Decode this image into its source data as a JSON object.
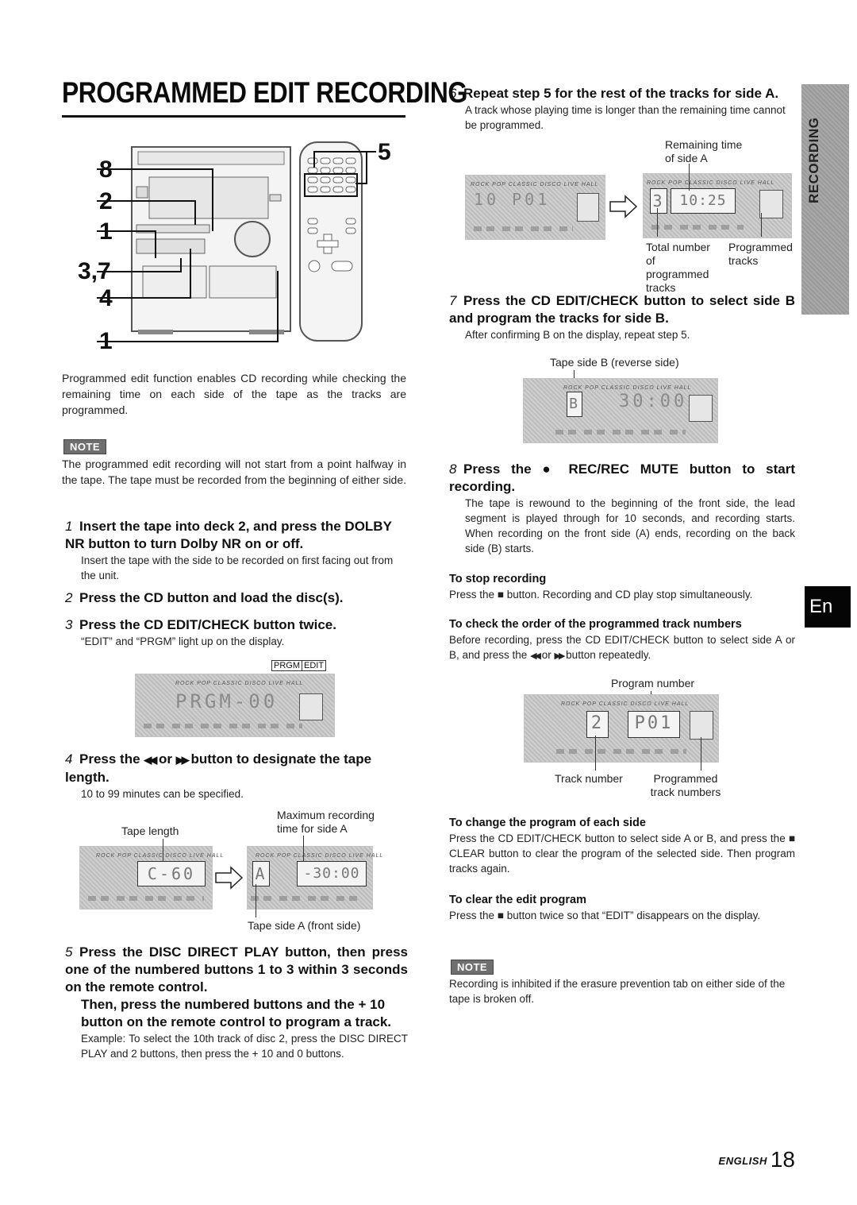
{
  "page": {
    "title": "PROGRAMMED EDIT RECORDING",
    "side_tab": "RECORDING",
    "lang_tab": "En",
    "footer_lang": "ENGLISH",
    "page_number": "18"
  },
  "illustration": {
    "callouts_left": [
      "8",
      "2",
      "1",
      "3,7",
      "4",
      "1"
    ],
    "callout_right": "5"
  },
  "intro": "Programmed edit function enables CD recording while checking the remaining time on each side of the tape as the tracks are programmed.",
  "note1": {
    "badge": "NOTE",
    "text": "The programmed edit recording will not start from a point halfway in the tape. The tape must be recorded from the beginning of either side."
  },
  "steps": [
    {
      "num": "1",
      "head": "Insert the tape into deck 2, and press the DOLBY NR button to turn Dolby NR on or off.",
      "body": "Insert the tape with the side to be recorded on first facing out from the unit."
    },
    {
      "num": "2",
      "head": "Press the CD button and load the disc(s).",
      "body": ""
    },
    {
      "num": "3",
      "head": "Press the CD EDIT/CHECK button twice.",
      "body": "“EDIT” and “PRGM” light up on the display."
    },
    {
      "num": "4",
      "head_pre": "Press the ",
      "head_rew": "◀◀",
      "head_mid": " or ",
      "head_ff": "▶▶",
      "head_post": " button to designate the tape length.",
      "body": "10 to 99 minutes can be specified."
    },
    {
      "num": "5",
      "head": "Press the DISC DIRECT PLAY button, then press one of the numbered buttons 1 to 3 within 3 seconds on the remote control.",
      "head2": "Then, press the numbered buttons and the + 10 button on the remote control to program a track.",
      "body": "Example: To select the 10th track of disc 2, press the DISC DIRECT PLAY and 2 buttons, then press the + 10 and 0 buttons."
    },
    {
      "num": "6",
      "head": "Repeat step 5 for the rest of the tracks for side A.",
      "body": "A track whose playing time is longer than the remaining time cannot be programmed."
    },
    {
      "num": "7",
      "head": "Press the CD EDIT/CHECK button to select side B and program the tracks for side B.",
      "body": "After confirming B on the display, repeat step 5."
    },
    {
      "num": "8",
      "head_pre": "Press the ",
      "head_icon": "●",
      "head_post": " REC/REC MUTE button to start recording.",
      "body": "The tape is rewound to the beginning of the front side, the lead segment is played through for 10 seconds, and recording starts.  When recording on the front side (A) ends, recording on the back side (B) starts."
    }
  ],
  "displays": {
    "step3": {
      "labels": [
        "PRGM",
        "EDIT"
      ],
      "genres": "ROCK  POP  CLASSIC  DISCO  LIVE  HALL",
      "segment": "PRGM-00"
    },
    "step4": {
      "left_label": "Tape length",
      "left_value": "C-60",
      "right_label_top": "Maximum recording time for side A",
      "right_side": "A",
      "right_value": "-30:00",
      "right_label_bottom": "Tape side A (front side)"
    },
    "step6": {
      "left_value": "10   P01",
      "label_top": "Remaining time of side A",
      "total": "3",
      "remaining": "10:25",
      "label_total": "Total number of programmed tracks",
      "label_programmed": "Programmed tracks"
    },
    "step7": {
      "label": "Tape side B (reverse side)",
      "side": "B",
      "value": "30:00"
    },
    "check": {
      "label_top": "Program number",
      "track": "2",
      "program": "P01",
      "label_track": "Track number",
      "label_programmed": "Programmed track numbers"
    }
  },
  "subsections": {
    "stop": {
      "head": "To stop recording",
      "pre": "Press the ",
      "icon": "■",
      "post": " button. Recording and CD play stop simultaneously."
    },
    "check": {
      "head": "To check the order of the programmed track numbers",
      "pre": "Before recording, press the CD EDIT/CHECK button to select side A or B, and press the ",
      "rew": "◀◀",
      "mid": " or ",
      "ff": "▶▶",
      "post": " button repeatedly."
    },
    "change": {
      "head": "To change the program of each side",
      "pre": "Press the CD EDIT/CHECK button to select side A or B, and press the ",
      "icon": "■",
      "post": " CLEAR button to clear the program of the selected side. Then program tracks again."
    },
    "clear": {
      "head": "To clear the edit program",
      "pre": "Press the ",
      "icon": "■",
      "post": " button twice so that “EDIT” disappears on the display."
    }
  },
  "note2": {
    "badge": "NOTE",
    "text": "Recording is inhibited if the erasure prevention tab on either side of the tape is broken off."
  }
}
